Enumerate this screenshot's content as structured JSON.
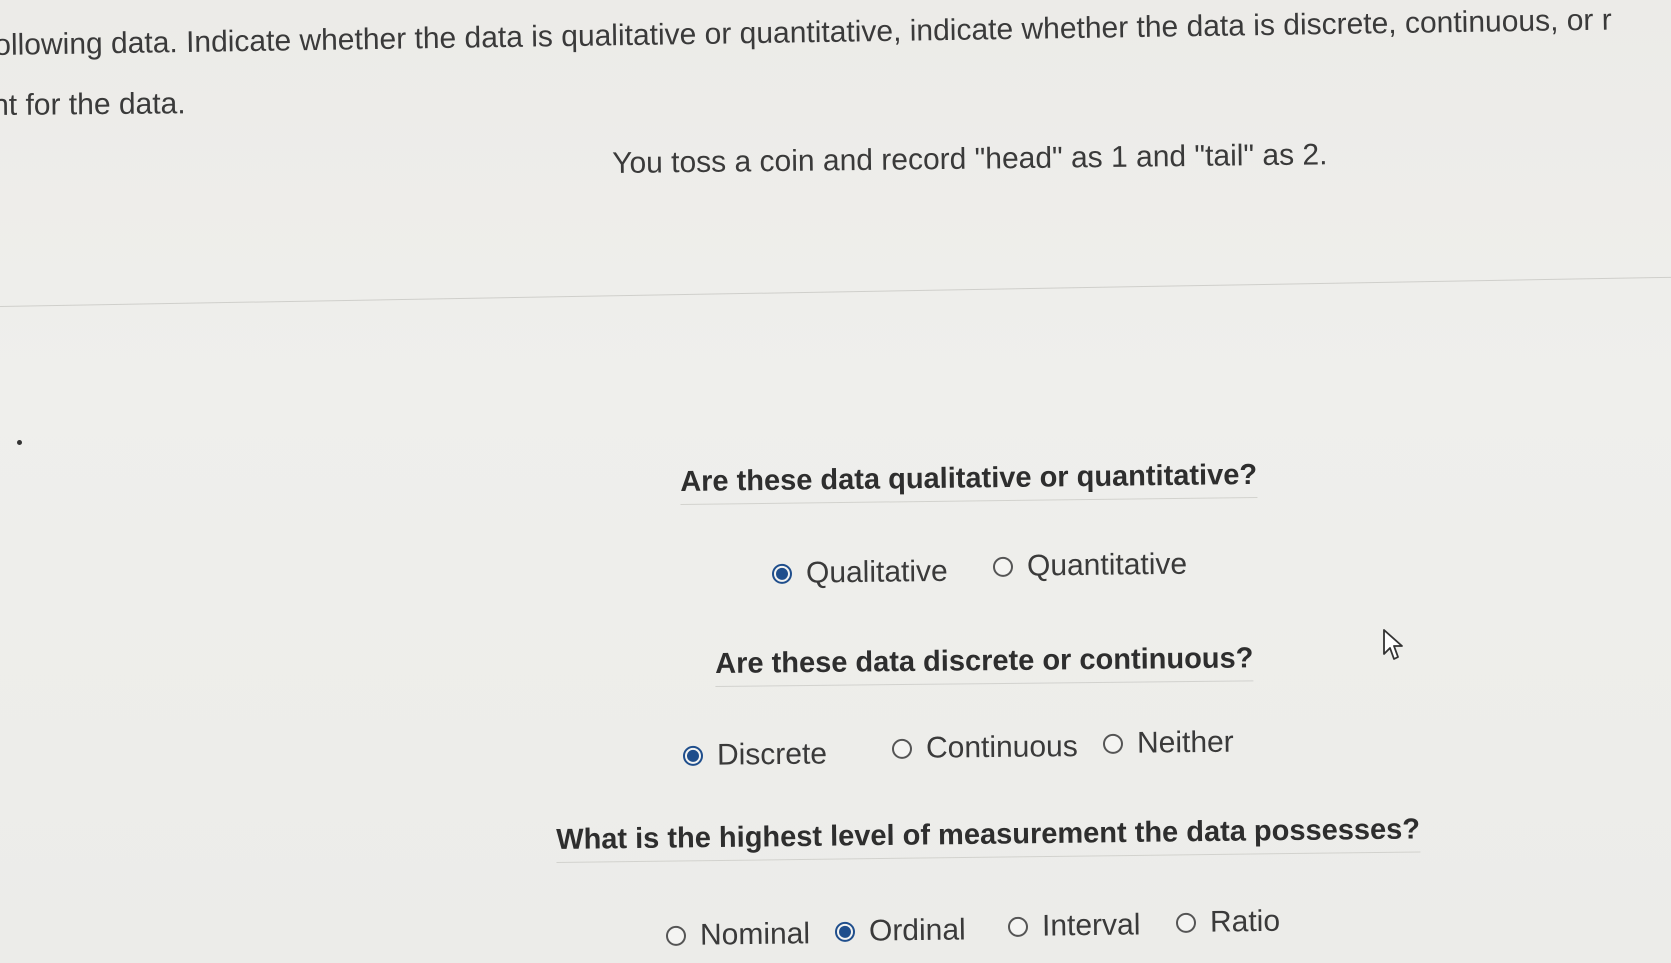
{
  "intro": {
    "line1": "ollowing data. Indicate whether the data is qualitative or quantitative, indicate whether the data is discrete, continuous, or r",
    "line2": "nt for the data."
  },
  "prompt": "You toss a coin and record \"head\" as 1 and \"tail\" as 2.",
  "questions": [
    {
      "text": "Are these data qualitative or quantitative?",
      "options": [
        {
          "label": "Qualitative",
          "selected": true
        },
        {
          "label": "Quantitative",
          "selected": false
        }
      ]
    },
    {
      "text": "Are these data discrete or continuous?",
      "options": [
        {
          "label": "Discrete",
          "selected": true
        },
        {
          "label": "Continuous",
          "selected": false
        },
        {
          "label": "Neither",
          "selected": false
        }
      ]
    },
    {
      "text": "What is the highest level of measurement the data possesses?",
      "options": [
        {
          "label": "Nominal",
          "selected": false
        },
        {
          "label": "Ordinal",
          "selected": true
        },
        {
          "label": "Interval",
          "selected": false
        },
        {
          "label": "Ratio",
          "selected": false
        }
      ]
    }
  ],
  "colors": {
    "radio_selected": "#1f4e8c",
    "text": "#333333",
    "background": "#eeeeec"
  },
  "icons": {
    "cursor": "mouse-pointer-icon"
  }
}
